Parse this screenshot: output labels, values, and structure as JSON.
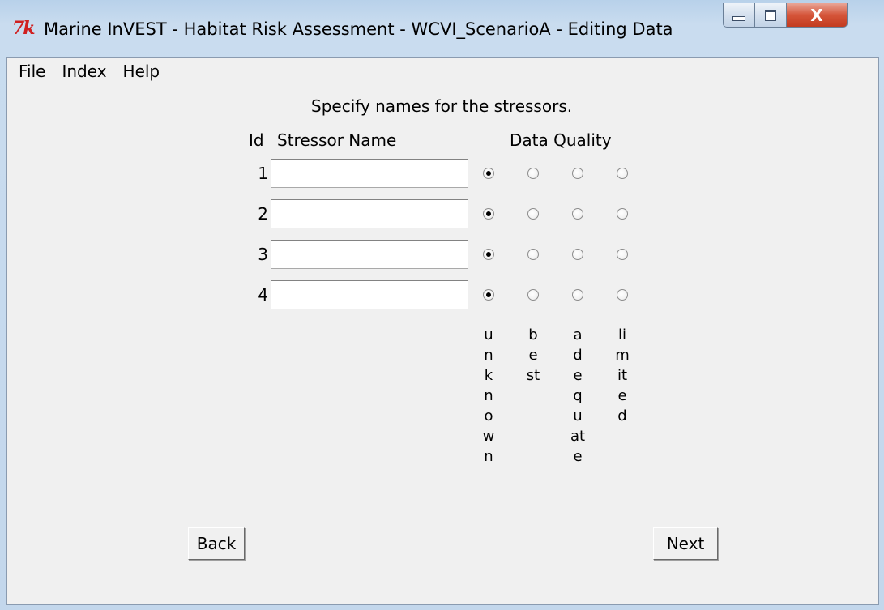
{
  "window": {
    "title": "Marine InVEST - Habitat Risk Assessment - WCVI_ScenarioA - Editing Data",
    "logo_text": "7k",
    "close_glyph": "X"
  },
  "menu": {
    "items": [
      "File",
      "Index",
      "Help"
    ]
  },
  "form": {
    "instruction": "Specify names for the stressors.",
    "headers": {
      "id": "Id",
      "name": "Stressor Name",
      "data_quality": "Data Quality"
    },
    "rows": [
      {
        "id": "1",
        "name": "",
        "quality": "unknown"
      },
      {
        "id": "2",
        "name": "",
        "quality": "unknown"
      },
      {
        "id": "3",
        "name": "",
        "quality": "unknown"
      },
      {
        "id": "4",
        "name": "",
        "quality": "unknown"
      }
    ],
    "quality_options": [
      "unknown",
      "best",
      "adequate",
      "limited"
    ]
  },
  "buttons": {
    "back": "Back",
    "next": "Next"
  }
}
